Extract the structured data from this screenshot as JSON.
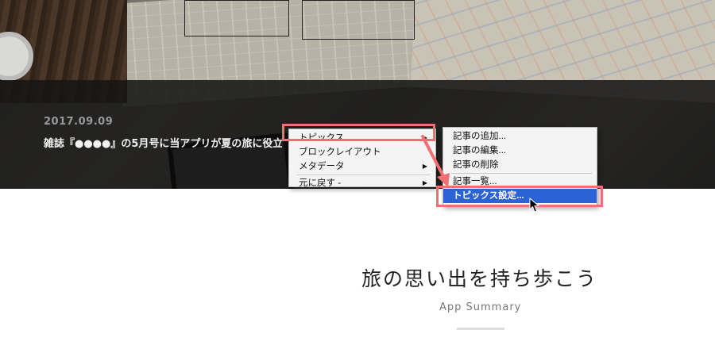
{
  "hero": {
    "date": "2017.09.09",
    "headline": "雑誌『●●●●』の5月号に当アプリが夏の旅に役立"
  },
  "context_menu": {
    "items": [
      {
        "label": "トピックス",
        "has_submenu": true
      },
      {
        "label": "ブロックレイアウト",
        "has_submenu": false
      },
      {
        "label": "メタデータ",
        "has_submenu": true
      },
      {
        "label": "元に戻す -",
        "has_submenu": true
      }
    ]
  },
  "submenu": {
    "items": [
      {
        "label": "記事の追加..."
      },
      {
        "label": "記事の編集..."
      },
      {
        "label": "記事の削除"
      },
      {
        "label": "記事一覧..."
      },
      {
        "label": "トピックス設定...",
        "selected": true
      }
    ]
  },
  "section": {
    "heading": "旅の思い出を持ち歩こう",
    "subheading": "App Summary"
  },
  "colors": {
    "highlight_outline": "#f06f72",
    "selection": "#2b62d6"
  },
  "icons": [
    "submenu-arrow-icon",
    "annotation-arrow-icon",
    "mouse-cursor-icon"
  ]
}
